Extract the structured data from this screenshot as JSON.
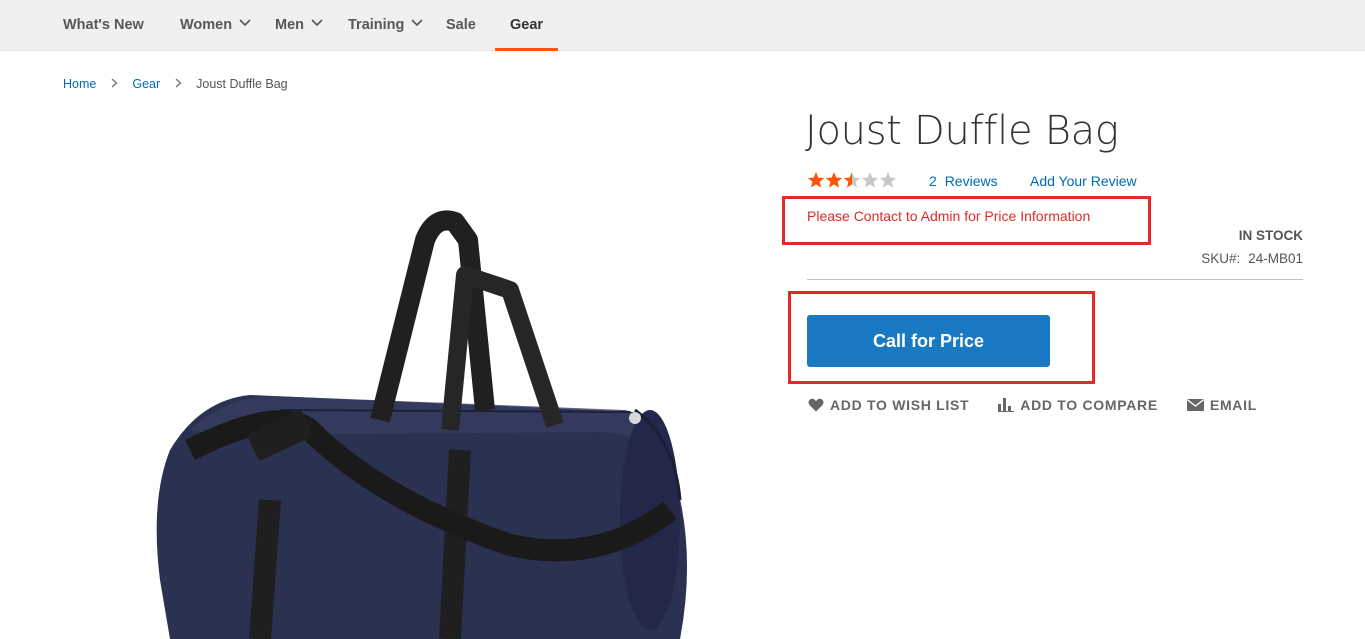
{
  "nav": {
    "items": [
      {
        "label": "What's New",
        "has_dropdown": false
      },
      {
        "label": "Women",
        "has_dropdown": true
      },
      {
        "label": "Men",
        "has_dropdown": true
      },
      {
        "label": "Training",
        "has_dropdown": true
      },
      {
        "label": "Sale",
        "has_dropdown": false
      },
      {
        "label": "Gear",
        "has_dropdown": false,
        "active": true
      }
    ],
    "active_color": "#ff5501"
  },
  "breadcrumb": {
    "items": [
      "Home",
      "Gear"
    ],
    "current": "Joust Duffle Bag",
    "separator": ">"
  },
  "product": {
    "title": "Joust Duffle Bag",
    "image_icon": "duffle-bag-photo",
    "rating": {
      "stars_filled": 2.5,
      "stars_total": 5,
      "color": "#ff5501"
    },
    "reviews_count": "2",
    "reviews_label": "Reviews",
    "add_review_label": "Add Your Review",
    "price_message": "Please Contact to Admin for Price Information",
    "stock_status": "IN STOCK",
    "sku_label": "SKU#:",
    "sku_value": "24-MB01",
    "cta_label": "Call for Price",
    "cta_color": "#1979c3",
    "highlight_color": "#e02b27"
  },
  "actions": [
    {
      "label": "ADD TO WISH LIST",
      "icon": "heart-icon"
    },
    {
      "label": "ADD TO COMPARE",
      "icon": "bar-chart-icon"
    },
    {
      "label": "EMAIL",
      "icon": "envelope-icon"
    }
  ]
}
